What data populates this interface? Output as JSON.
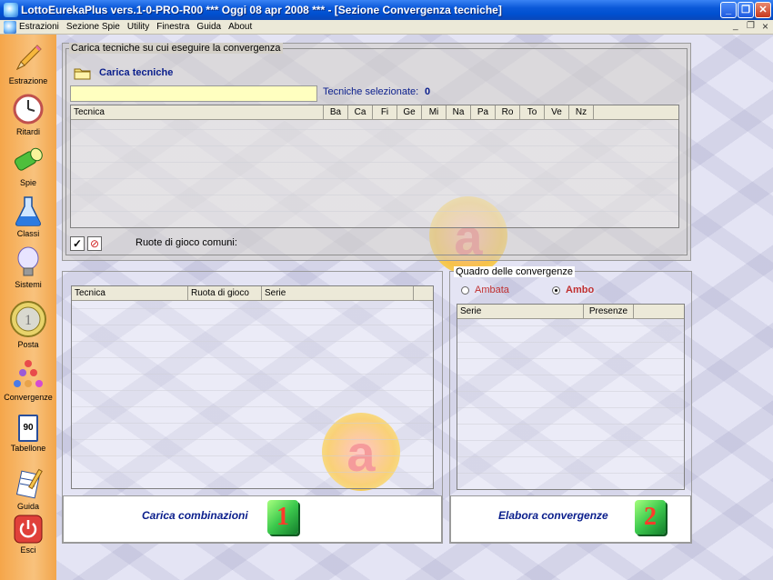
{
  "window": {
    "title": "LottoEurekaPlus vers.1-0-PRO-R00  ***  Oggi 08 apr 2008  ***   - [Sezione Convergenza tecniche]",
    "minimize": "_",
    "restore": "❐",
    "close": "✕"
  },
  "menu": {
    "items": [
      "Estrazioni",
      "Sezione Spie",
      "Utility",
      "Finestra",
      "Guida",
      "About"
    ],
    "mdi_min": "_",
    "mdi_restore": "❐",
    "mdi_close": "×"
  },
  "sidebar": {
    "items": [
      {
        "label": "Estrazione",
        "icon": "pencil-icon"
      },
      {
        "label": "Ritardi",
        "icon": "clock-icon"
      },
      {
        "label": "Spie",
        "icon": "flashlight-icon"
      },
      {
        "label": "Classi",
        "icon": "flask-icon"
      },
      {
        "label": "Sistemi",
        "icon": "lightbulb-icon"
      },
      {
        "label": "Posta",
        "icon": "coin-icon"
      },
      {
        "label": "Convergenze",
        "icon": "balls-icon"
      },
      {
        "label": "Tabellone",
        "icon": "calendar-icon"
      },
      {
        "label": "Guida",
        "icon": "notebook-icon"
      },
      {
        "label": "Esci",
        "icon": "power-icon"
      }
    ],
    "tabellone_number": "90"
  },
  "tech_panel": {
    "legend": "Carica tecniche su cui eseguire la convergenza",
    "load_label": "Carica tecniche",
    "input_value": "",
    "selected_label": "Tecniche selezionate:",
    "selected_count": "0",
    "columns": [
      "Tecnica",
      "Ba",
      "Ca",
      "Fi",
      "Ge",
      "Mi",
      "Na",
      "Pa",
      "Ro",
      "To",
      "Ve",
      "Nz"
    ],
    "check_all": "✓",
    "clear_all": "⊘",
    "common_wheels_label": "Ruote di gioco comuni:"
  },
  "combo_panel": {
    "columns": [
      "Tecnica",
      "Ruota di gioco",
      "Serie"
    ],
    "load_button": "Carica combinazioni",
    "step": "1"
  },
  "convergence_panel": {
    "legend": "Quadro delle convergenze",
    "options": [
      "Ambata",
      "Ambo"
    ],
    "selected": "Ambo",
    "columns": [
      "Serie",
      "Presenze"
    ],
    "process_button": "Elabora convergenze",
    "step": "2"
  },
  "colors": {
    "titlebar": "#0a58d8",
    "sidebar": "#f5a64a",
    "input_yellow": "#ffffc0",
    "button_text": "#0a1e8c",
    "badge_green": "#3cc94d",
    "badge_red": "#ff3a2a"
  }
}
